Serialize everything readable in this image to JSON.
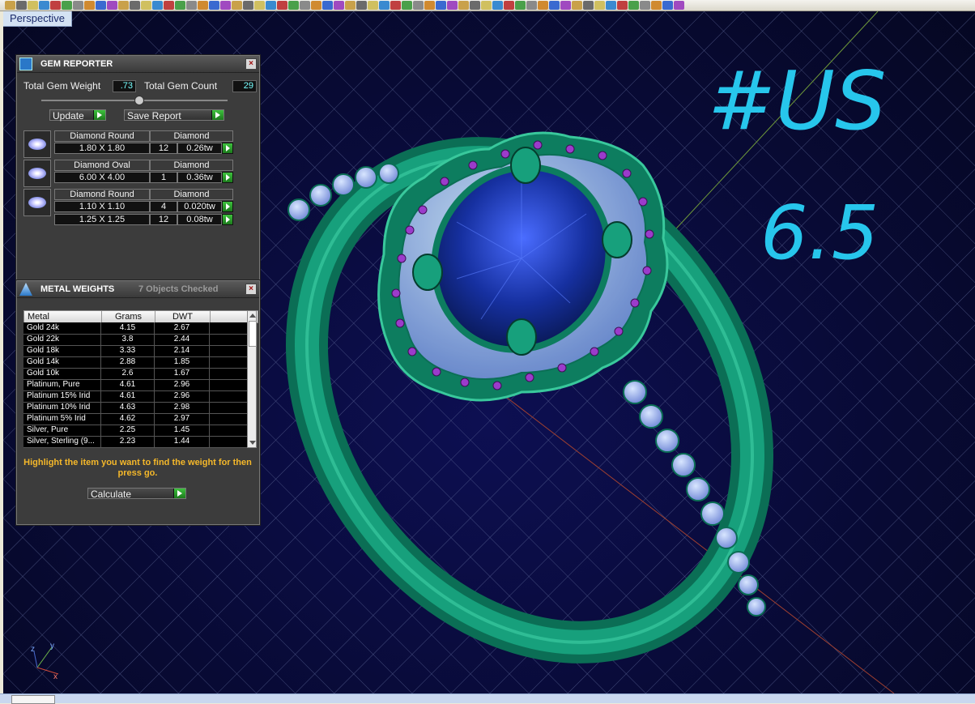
{
  "viewport": {
    "label": "Perspective",
    "annotation_line1": "#US",
    "annotation_line2": "6.5",
    "background": "#080a34",
    "ring_metal_color": "#0e8f6a",
    "center_stone_color": "#1a2fa8",
    "accent_stone_color": "#9a3ac0"
  },
  "gem_reporter": {
    "title": "GEM REPORTER",
    "total_weight_label": "Total Gem Weight",
    "total_weight_value": ".73",
    "total_count_label": "Total Gem Count",
    "total_count_value": "29",
    "update_label": "Update",
    "save_report_label": "Save Report",
    "gems": [
      {
        "name": "Diamond Round",
        "material": "Diamond",
        "size": "1.80 X 1.80",
        "count": "12",
        "weight": "0.26tw"
      },
      {
        "name": "Diamond Oval",
        "material": "Diamond",
        "size": "6.00 X 4.00",
        "count": "1",
        "weight": "0.36tw"
      },
      {
        "name": "Diamond Round",
        "material": "Diamond",
        "size": "1.10 X 1.10",
        "count": "4",
        "weight": "0.020tw",
        "size2": "1.25 X 1.25",
        "count2": "12",
        "weight2": "0.08tw"
      }
    ]
  },
  "metal_weights": {
    "title": "METAL WEIGHTS",
    "status": "7 Objects Checked",
    "columns": [
      "Metal",
      "Grams",
      "DWT"
    ],
    "rows": [
      [
        "Gold 24k",
        "4.15",
        "2.67"
      ],
      [
        "Gold 22k",
        "3.8",
        "2.44"
      ],
      [
        "Gold 18k",
        "3.33",
        "2.14"
      ],
      [
        "Gold 14k",
        "2.88",
        "1.85"
      ],
      [
        "Gold 10k",
        "2.6",
        "1.67"
      ],
      [
        "Platinum, Pure",
        "4.61",
        "2.96"
      ],
      [
        "Platinum 15% Irid",
        "4.61",
        "2.96"
      ],
      [
        "Platinum 10% Irid",
        "4.63",
        "2.98"
      ],
      [
        "Platinum 5% Irid",
        "4.62",
        "2.97"
      ],
      [
        "Silver, Pure",
        "2.25",
        "1.45"
      ],
      [
        "Silver, Sterling (9...",
        "2.23",
        "1.44"
      ]
    ],
    "hint": "Highlight the item you want to find the weight for then press go.",
    "calculate_label": "Calculate"
  }
}
